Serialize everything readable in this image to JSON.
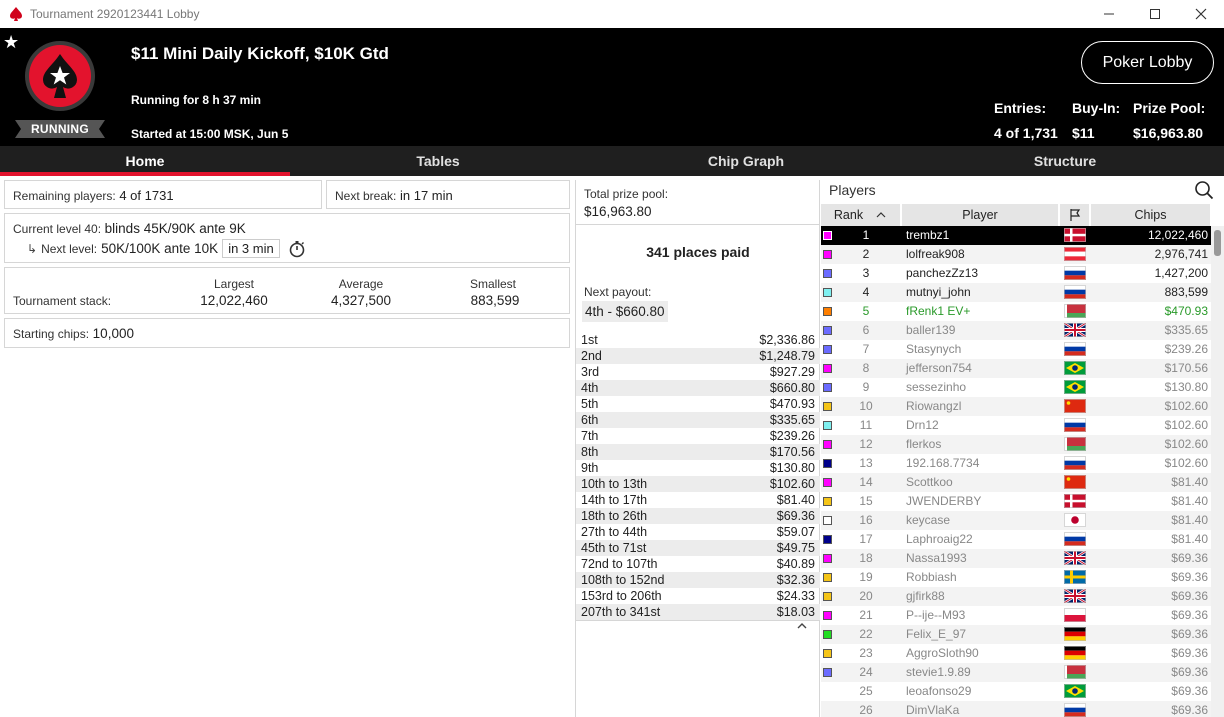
{
  "window": {
    "title": "Tournament 2920123441 Lobby"
  },
  "header": {
    "name": "$11 Mini Daily Kickoff, $10K Gtd",
    "running_for": "Running for 8 h 37 min",
    "started_at": "Started at 15:00 MSK, Jun 5",
    "status_badge": "RUNNING",
    "poker_lobby_label": "Poker Lobby",
    "entries_label": "Entries:",
    "entries_value": "4 of 1,731",
    "buyin_label": "Buy-In:",
    "buyin_value": "$11",
    "prize_label": "Prize Pool:",
    "prize_value": "$16,963.80"
  },
  "tabs": [
    "Home",
    "Tables",
    "Chip Graph",
    "Structure"
  ],
  "home": {
    "remaining_label": "Remaining players:",
    "remaining_value": "4 of 1731",
    "next_break_label": "Next break:",
    "next_break_value": "in 17 min",
    "current_level_label": "Current level 40:",
    "current_level_value": "blinds 45K/90K ante 9K",
    "next_level_label": "Next level:",
    "next_level_value": "50K/100K ante 10K",
    "next_level_timer": "in 3 min",
    "stack_label": "Tournament stack:",
    "largest_label": "Largest",
    "largest_value": "12,022,460",
    "average_label": "Average",
    "average_value": "4,327,500",
    "smallest_label": "Smallest",
    "smallest_value": "883,599",
    "starting_label": "Starting chips:",
    "starting_value": "10,000"
  },
  "prize": {
    "total_label": "Total prize pool:",
    "total_value": "$16,963.80",
    "places_paid": "341 places paid",
    "next_payout_label": "Next payout:",
    "next_payout_value": "4th - $660.80",
    "payouts": [
      {
        "place": "1st",
        "amount": "$2,336.86"
      },
      {
        "place": "2nd",
        "amount": "$1,248.79"
      },
      {
        "place": "3rd",
        "amount": "$927.29"
      },
      {
        "place": "4th",
        "amount": "$660.80"
      },
      {
        "place": "5th",
        "amount": "$470.93"
      },
      {
        "place": "6th",
        "amount": "$335.65"
      },
      {
        "place": "7th",
        "amount": "$239.26"
      },
      {
        "place": "8th",
        "amount": "$170.56"
      },
      {
        "place": "9th",
        "amount": "$130.80"
      },
      {
        "place": "10th to 13th",
        "amount": "$102.60"
      },
      {
        "place": "14th to 17th",
        "amount": "$81.40"
      },
      {
        "place": "18th to 26th",
        "amount": "$69.36"
      },
      {
        "place": "27th to 44th",
        "amount": "$59.07"
      },
      {
        "place": "45th to 71st",
        "amount": "$49.75"
      },
      {
        "place": "72nd to 107th",
        "amount": "$40.89"
      },
      {
        "place": "108th to 152nd",
        "amount": "$32.36"
      },
      {
        "place": "153rd to 206th",
        "amount": "$24.33"
      },
      {
        "place": "207th to 341st",
        "amount": "$18.03"
      }
    ]
  },
  "players": {
    "title": "Players",
    "col_rank": "Rank",
    "col_player": "Player",
    "col_chips": "Chips",
    "rows": [
      {
        "rank": "1",
        "name": "trembz1",
        "chips": "12,022,460",
        "tag": "#ff00ff",
        "flag": "DK",
        "style": "self"
      },
      {
        "rank": "2",
        "name": "lolfreak908",
        "chips": "2,976,741",
        "tag": "#ff00ff",
        "flag": "AT",
        "style": ""
      },
      {
        "rank": "3",
        "name": "panchezZz13",
        "chips": "1,427,200",
        "tag": "#6b6bff",
        "flag": "RU",
        "style": ""
      },
      {
        "rank": "4",
        "name": "mutnyi_john",
        "chips": "883,599",
        "tag": "#7ff0f0",
        "flag": "RU",
        "style": ""
      },
      {
        "rank": "5",
        "name": "fRenk1 EV+",
        "chips": "$470.93",
        "tag": "#ff7f00",
        "flag": "BY",
        "style": "green"
      },
      {
        "rank": "6",
        "name": "baller139",
        "chips": "$335.65",
        "tag": "#6b6bff",
        "flag": "GB",
        "style": "dim"
      },
      {
        "rank": "7",
        "name": "Stasynych",
        "chips": "$239.26",
        "tag": "#6b6bff",
        "flag": "RU",
        "style": "dim"
      },
      {
        "rank": "8",
        "name": "jefferson754",
        "chips": "$170.56",
        "tag": "#ff00ff",
        "flag": "BR",
        "style": "dim"
      },
      {
        "rank": "9",
        "name": "sessezinho",
        "chips": "$130.80",
        "tag": "#6b6bff",
        "flag": "BR",
        "style": "dim"
      },
      {
        "rank": "10",
        "name": "Riowangzl",
        "chips": "$102.60",
        "tag": "#f5c518",
        "flag": "CN",
        "style": "dim"
      },
      {
        "rank": "11",
        "name": "Drn12",
        "chips": "$102.60",
        "tag": "#7ff0f0",
        "flag": "RU",
        "style": "dim"
      },
      {
        "rank": "12",
        "name": "flerkos",
        "chips": "$102.60",
        "tag": "#ff00ff",
        "flag": "BY",
        "style": "dim"
      },
      {
        "rank": "13",
        "name": "192.168.7734",
        "chips": "$102.60",
        "tag": "#00008b",
        "flag": "RU",
        "style": "dim"
      },
      {
        "rank": "14",
        "name": "Scottkoo",
        "chips": "$81.40",
        "tag": "#ff00ff",
        "flag": "CN",
        "style": "dim"
      },
      {
        "rank": "15",
        "name": "JWENDERBY",
        "chips": "$81.40",
        "tag": "#f5c518",
        "flag": "DK",
        "style": "dim"
      },
      {
        "rank": "16",
        "name": "keycase",
        "chips": "$81.40",
        "tag": "#ffffff",
        "flag": "JP",
        "style": "dim"
      },
      {
        "rank": "17",
        "name": "Laphroaig22",
        "chips": "$81.40",
        "tag": "#00008b",
        "flag": "RU",
        "style": "dim"
      },
      {
        "rank": "18",
        "name": "Nassa1993",
        "chips": "$69.36",
        "tag": "#ff00ff",
        "flag": "GB",
        "style": "dim"
      },
      {
        "rank": "19",
        "name": "Robbiash",
        "chips": "$69.36",
        "tag": "#f5c518",
        "flag": "SE",
        "style": "dim"
      },
      {
        "rank": "20",
        "name": "gjfirk88",
        "chips": "$69.36",
        "tag": "#f5c518",
        "flag": "GB",
        "style": "dim"
      },
      {
        "rank": "21",
        "name": "P--ije--M93",
        "chips": "$69.36",
        "tag": "#ff00ff",
        "flag": "PL",
        "style": "dim"
      },
      {
        "rank": "22",
        "name": "Felix_E_97",
        "chips": "$69.36",
        "tag": "#22dd22",
        "flag": "DE",
        "style": "dim"
      },
      {
        "rank": "23",
        "name": "AggroSloth90",
        "chips": "$69.36",
        "tag": "#f5c518",
        "flag": "DE",
        "style": "dim"
      },
      {
        "rank": "24",
        "name": "stevie1.9.89",
        "chips": "$69.36",
        "tag": "#6b6bff",
        "flag": "BY",
        "style": "dim"
      },
      {
        "rank": "25",
        "name": "leoafonso29",
        "chips": "$69.36",
        "tag": "",
        "flag": "BR",
        "style": "dim"
      },
      {
        "rank": "26",
        "name": "DimVlaKa",
        "chips": "$69.36",
        "tag": "",
        "flag": "RU",
        "style": "dim"
      }
    ]
  },
  "colors": {
    "accent_red": "#e3132d",
    "header_bg": "#000000",
    "tab_bg": "#1f1f1f"
  }
}
